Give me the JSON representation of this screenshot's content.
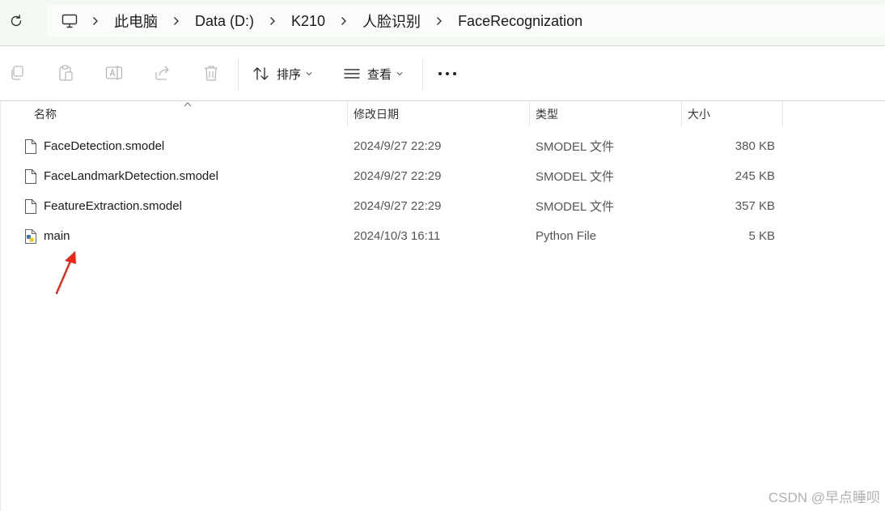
{
  "breadcrumb": [
    "此电脑",
    "Data (D:)",
    "K210",
    "人脸识别",
    "FaceRecognization"
  ],
  "toolbar": {
    "sort_label": "排序",
    "view_label": "查看"
  },
  "columns": {
    "name": "名称",
    "date": "修改日期",
    "type": "类型",
    "size": "大小"
  },
  "files": [
    {
      "name": "FaceDetection.smodel",
      "date": "2024/9/27 22:29",
      "type": "SMODEL 文件",
      "size": "380 KB",
      "icon": "file-icon"
    },
    {
      "name": "FaceLandmarkDetection.smodel",
      "date": "2024/9/27 22:29",
      "type": "SMODEL 文件",
      "size": "245 KB",
      "icon": "file-icon"
    },
    {
      "name": "FeatureExtraction.smodel",
      "date": "2024/9/27 22:29",
      "type": "SMODEL 文件",
      "size": "357 KB",
      "icon": "file-icon"
    },
    {
      "name": "main",
      "date": "2024/10/3 16:11",
      "type": "Python File",
      "size": "5 KB",
      "icon": "python-file-icon"
    }
  ],
  "watermark": "CSDN @早点睡呗",
  "colors": {
    "address_bg": "#f2f8f2",
    "annotation_arrow": "#e8261a",
    "python_blue": "#3a76b0",
    "python_yellow": "#f5c518"
  }
}
